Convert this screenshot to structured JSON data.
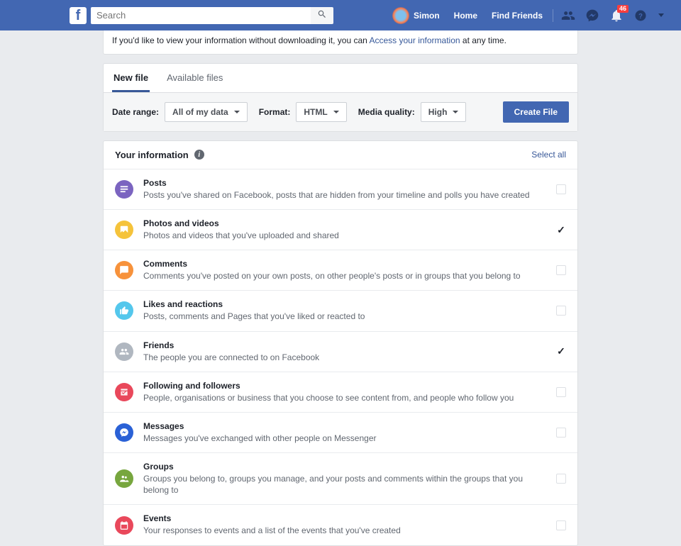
{
  "topbar": {
    "search_placeholder": "Search",
    "user_name": "Simon",
    "nav_home": "Home",
    "nav_find_friends": "Find Friends",
    "notification_count": "46"
  },
  "intro": {
    "prefix": "If you'd like to view your information without downloading it, you can ",
    "link": "Access your information",
    "suffix": " at any time."
  },
  "tabs": {
    "new_file": "New file",
    "available_files": "Available files"
  },
  "filters": {
    "date_range_label": "Date range:",
    "date_range_value": "All of my data",
    "format_label": "Format:",
    "format_value": "HTML",
    "media_quality_label": "Media quality:",
    "media_quality_value": "High",
    "create_button": "Create File"
  },
  "list": {
    "heading": "Your information",
    "select_all": "Select all",
    "items": [
      {
        "title": "Posts",
        "desc": "Posts you've shared on Facebook, posts that are hidden from your timeline and polls you have created",
        "checked": false
      },
      {
        "title": "Photos and videos",
        "desc": "Photos and videos that you've uploaded and shared",
        "checked": true
      },
      {
        "title": "Comments",
        "desc": "Comments you've posted on your own posts, on other people's posts or in groups that you belong to",
        "checked": false
      },
      {
        "title": "Likes and reactions",
        "desc": "Posts, comments and Pages that you've liked or reacted to",
        "checked": false
      },
      {
        "title": "Friends",
        "desc": "The people you are connected to on Facebook",
        "checked": true
      },
      {
        "title": "Following and followers",
        "desc": "People, organisations or business that you choose to see content from, and people who follow you",
        "checked": false
      },
      {
        "title": "Messages",
        "desc": "Messages you've exchanged with other people on Messenger",
        "checked": false
      },
      {
        "title": "Groups",
        "desc": "Groups you belong to, groups you manage, and your posts and comments within the groups that you belong to",
        "checked": false
      },
      {
        "title": "Events",
        "desc": "Your responses to events and a list of the events that you've created",
        "checked": false
      }
    ]
  }
}
